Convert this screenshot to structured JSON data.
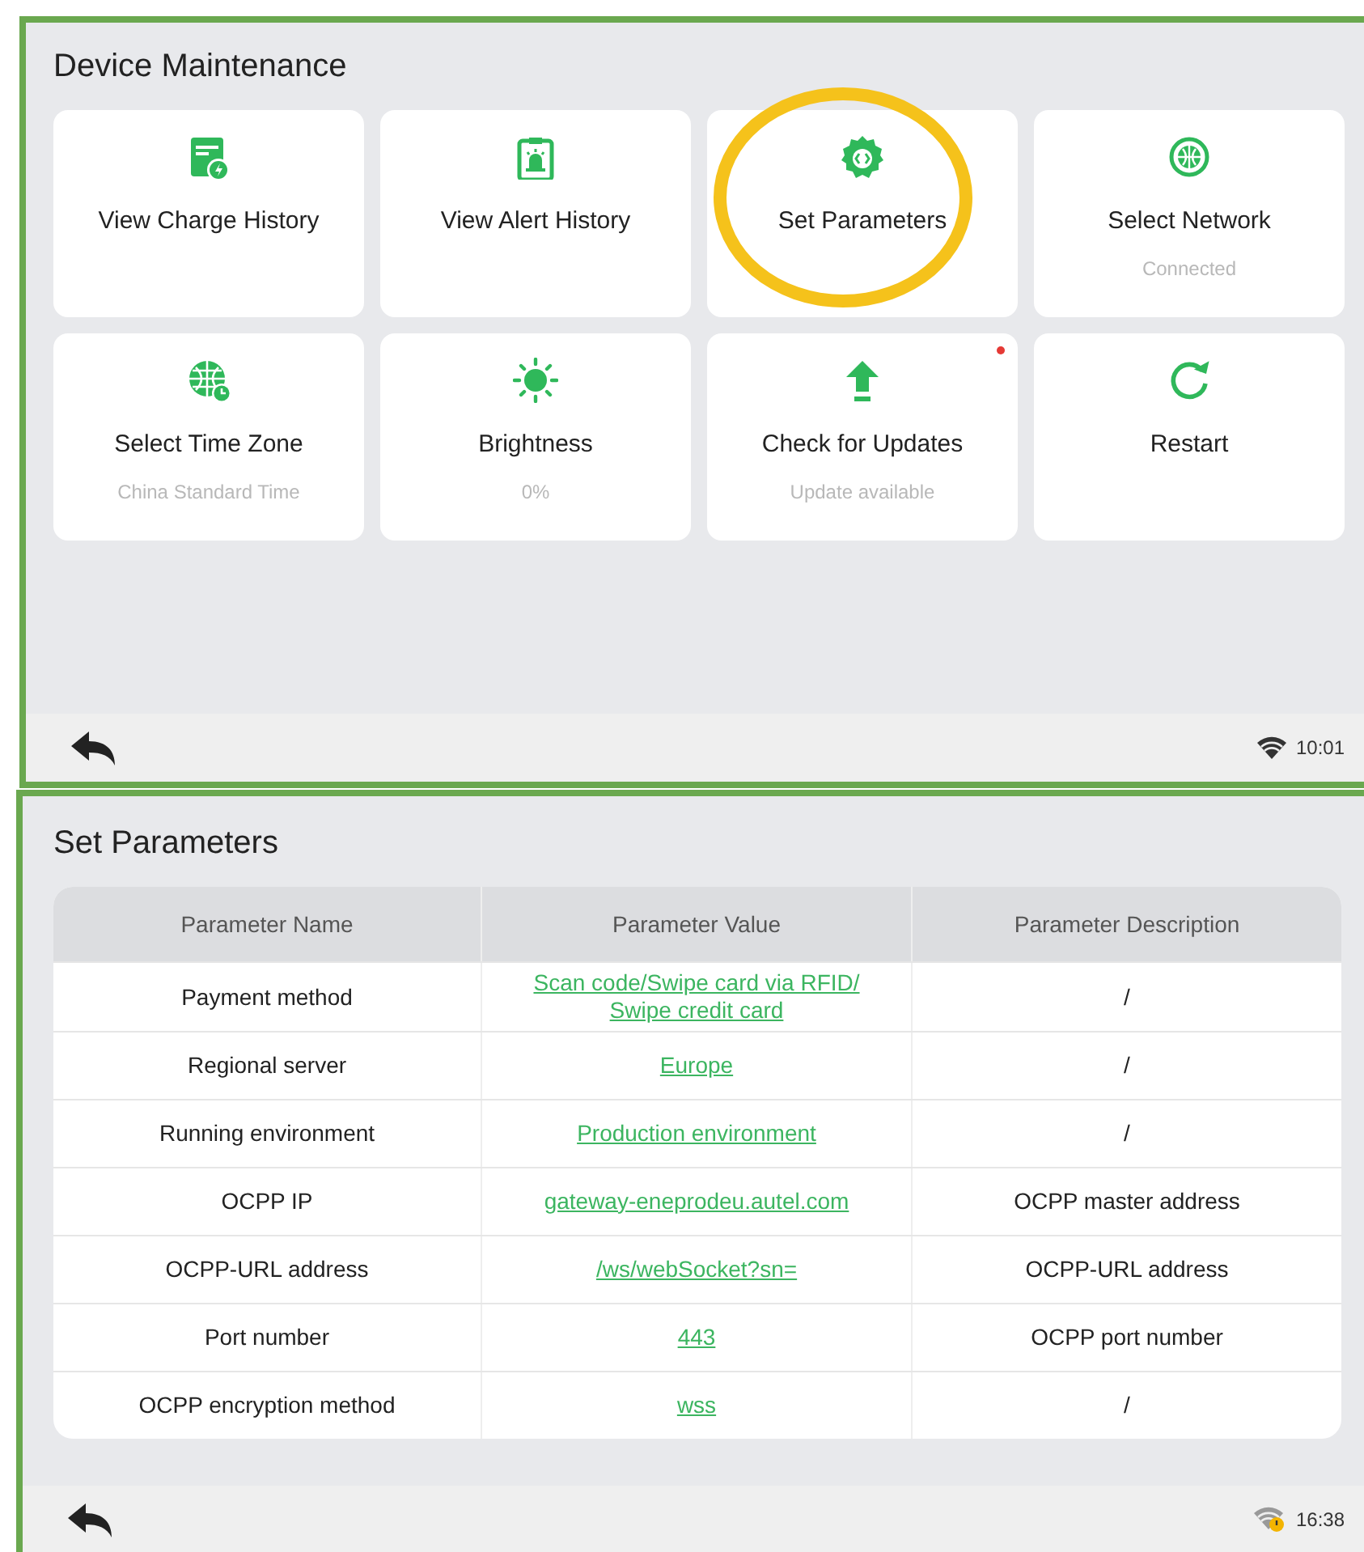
{
  "maintenance_screen": {
    "title": "Device Maintenance",
    "cards": [
      {
        "label": "View Charge History",
        "notification": false,
        "highlighted": false
      },
      {
        "label": "View Alert History",
        "notification": false,
        "highlighted": false
      },
      {
        "label": "Set Parameters",
        "notification": false,
        "highlighted": true
      },
      {
        "label": "Select Network",
        "subtitle": "Connected",
        "notification": false,
        "highlighted": false
      },
      {
        "label": "Select Time Zone",
        "subtitle": "China Standard Time",
        "notification": false,
        "highlighted": false
      },
      {
        "label": "Brightness",
        "subtitle": "0%",
        "notification": false,
        "highlighted": false
      },
      {
        "label": "Check for Updates",
        "subtitle": "Update available",
        "notification": true,
        "highlighted": false
      },
      {
        "label": "Restart",
        "notification": false,
        "highlighted": false
      }
    ],
    "status_bar": {
      "time": "10:01"
    }
  },
  "parameters_screen": {
    "title": "Set Parameters",
    "table": {
      "columns": [
        "Parameter Name",
        "Parameter Value",
        "Parameter Description"
      ],
      "rows": [
        {
          "name": "Payment method",
          "value": "Scan code/Swipe card via RFID/\nSwipe credit card",
          "description": "/"
        },
        {
          "name": "Regional server",
          "value": "Europe",
          "description": "/"
        },
        {
          "name": "Running environment",
          "value": "Production environment",
          "description": "/"
        },
        {
          "name": "OCPP IP",
          "value": "gateway-eneprodeu.autel.com",
          "description": "OCPP master address"
        },
        {
          "name": "OCPP-URL address",
          "value": "/ws/webSocket?sn=",
          "description": "OCPP-URL address"
        },
        {
          "name": "Port number",
          "value": "443",
          "description": "OCPP port number"
        },
        {
          "name": "OCPP encryption method",
          "value": "wss",
          "description": "/"
        }
      ]
    },
    "status_bar": {
      "time": "16:38"
    }
  }
}
